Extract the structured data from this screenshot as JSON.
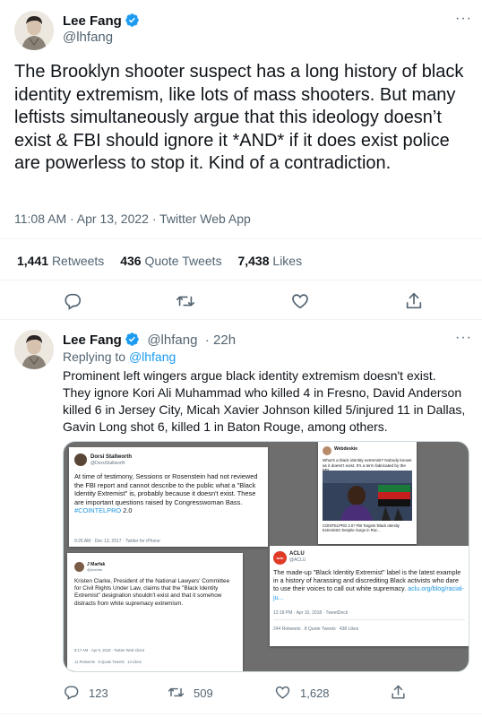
{
  "colors": {
    "accent": "#1d9bf0",
    "text": "#0f1419",
    "muted": "#536471"
  },
  "main_tweet": {
    "author_name": "Lee Fang",
    "author_handle": "@lhfang",
    "text": "The Brooklyn shooter suspect has a long history of black identity extremism, like lots of mass shooters. But many leftists simultaneously argue that this ideology doesn’t exist & FBI should ignore it *AND* if it does exist police are powerless to stop it. Kind of a contradiction.",
    "meta": "11:08 AM · Apr 13, 2022 · Twitter Web App",
    "stats": [
      {
        "value": "1,441",
        "label": "Retweets"
      },
      {
        "value": "436",
        "label": "Quote Tweets"
      },
      {
        "value": "7,438",
        "label": "Likes"
      }
    ],
    "actions": [
      "reply-icon",
      "retweet-icon",
      "like-icon",
      "share-icon"
    ]
  },
  "reply_tweet": {
    "author_name": "Lee Fang",
    "author_handle": "@lhfang",
    "time": "· 22h",
    "replying_prefix": "Replying to",
    "replying_handle": "@lhfang",
    "text": "Prominent left wingers argue black identity extremism doesn't exist. They ignore Kori Ali Muhammad who killed 4 in Fresno, David Anderson killed 6 in Jersey City, Micah Xavier Johnson killed 5/injured 11 in Dallas, Gavin Long shot 6, killed 1 in Baton Rouge, among others.",
    "reply_count": "123",
    "retweet_count": "509",
    "like_count": "1,628"
  },
  "media": {
    "shot1": {
      "name": "Dorsi Stallworth",
      "handle": "@DorsiStallworth",
      "body": "At time of testimony, Sessions or Rosenstein had not reviewed the FBI report and cannot describe to the public what a \"Black Identity Extremist\" is, probably because it doesn't exist. These are important questions raised by Congresswoman Bass.",
      "hashtag": "#COINTELPRO",
      "hashtag_suffix": " 2.0",
      "meta": "9:26 AM · Dec 13, 2017 · Twitter for iPhone"
    },
    "shot2": {
      "name": "Webdeskie",
      "handle": "@",
      "body": "What's a black identity extremist? Nobody knows as it doesn't exist. It's a term fabricated by the FBI",
      "link": "#",
      "caption": "COINTELPRO 2.0? FBI Targets 'Black Identity Extremists' Despite Surge in Rac..."
    },
    "shot3": {
      "name": "J Marfak",
      "handle": "@jmarfak",
      "body": "Kristen Clarke, President of the National Lawyers' Committee for Civil Rights Under Law, claims that the \"Black Identity Extremist\" designation shouldn't exist and that it somehow distracts from white supremacy extremism.",
      "meta": "8:17 AM · Apr 9, 2018 · Twitter Web Client",
      "stats": "11 Retweets   8 Quote Tweets   14 Likes"
    },
    "shot4": {
      "logo": "aclu",
      "name": "ACLU",
      "handle": "@ACLU",
      "body": "The made-up \"Black Identity Extremist\" label is the latest example in a history of harassing and discrediting Black activists who dare to use their voices to call out white supremacy.",
      "link": "aclu.org/blog/racial-ju...",
      "meta": "12:18 PM · Apr 10, 2018 · TweetDeck",
      "stats": "244 Retweets   8 Quote Tweets   438 Likes"
    }
  }
}
